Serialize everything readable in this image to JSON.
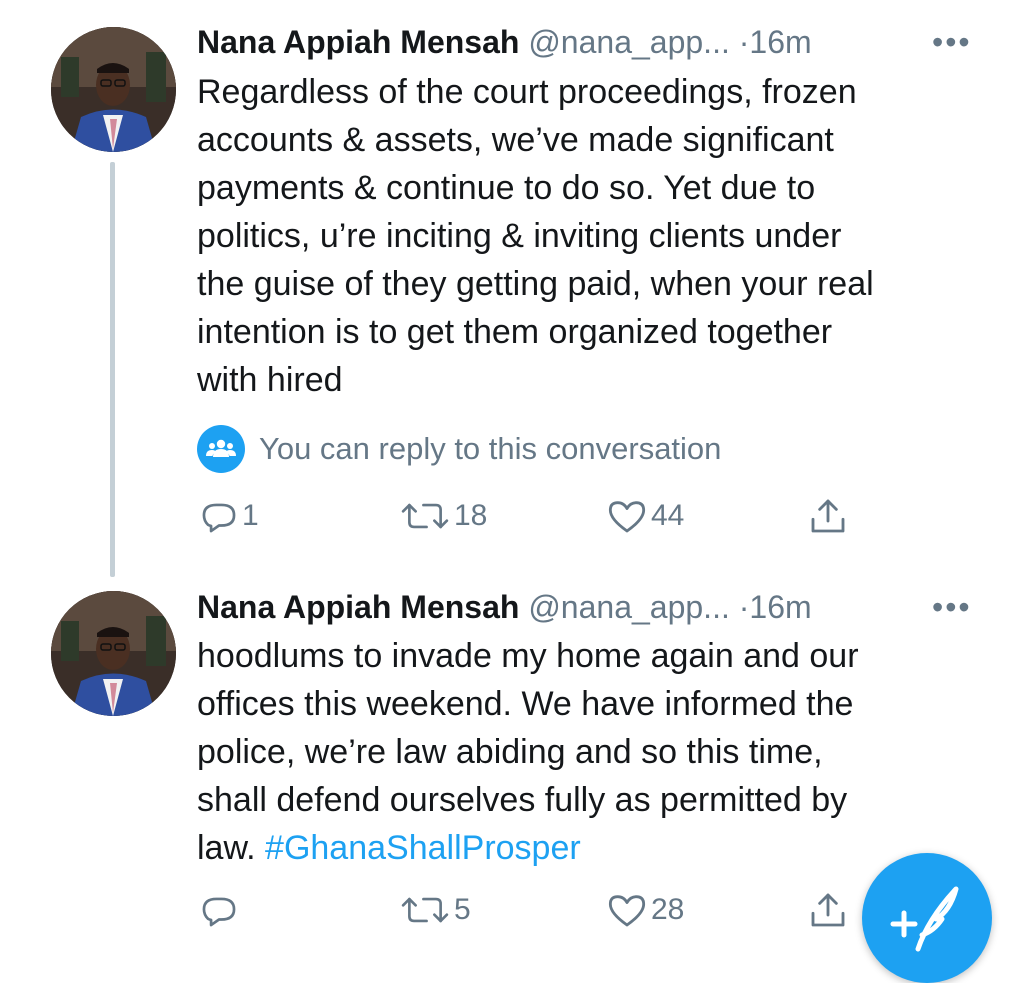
{
  "tweets": [
    {
      "author_name": "Nana Appiah Mensah",
      "handle": "@nana_app...",
      "separator": "·",
      "time": "16m",
      "more": "•••",
      "lines": [
        "Regardless of the court proceedings, frozen",
        "accounts & assets, we’ve made significant",
        "payments & continue to do so. Yet due to",
        "politics, u’re inciting & inviting clients under",
        "the guise of they getting paid, when your real",
        "intention is to get them organized together",
        "with hired"
      ],
      "reply_note": "You can reply to this conversation",
      "reply_count": "1",
      "retweet_count": "18",
      "like_count": "44"
    },
    {
      "author_name": "Nana Appiah Mensah",
      "handle": "@nana_app...",
      "separator": "·",
      "time": "16m",
      "more": "•••",
      "lines": [
        "hoodlums to invade my home again and our",
        "offices this weekend. We have informed the",
        "police, we’re law abiding and so this time,",
        "shall defend ourselves fully as permitted by",
        "law. "
      ],
      "hashtag": "#GhanaShallProsper",
      "retweet_count": "5",
      "like_count": "28"
    }
  ],
  "colors": {
    "accent": "#1da1f2",
    "muted": "#657786",
    "text": "#14171a",
    "thread_line": "#c4cfd6"
  },
  "icons": {
    "reply": "reply-icon",
    "retweet": "retweet-icon",
    "like": "heart-icon",
    "share": "share-icon",
    "compose": "compose-tweet-icon",
    "conversation": "people-icon"
  }
}
